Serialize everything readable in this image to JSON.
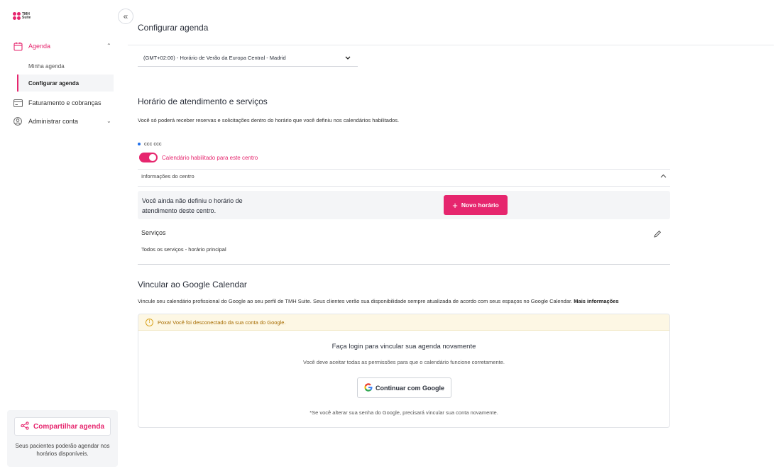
{
  "brand": {
    "logo_line1": "TMH",
    "logo_line2": "Suite",
    "accent": "#e6266e"
  },
  "sidebar": {
    "collapse_icon": "double-chevron-left-icon",
    "agenda": {
      "label": "Agenda",
      "icon": "calendar-icon"
    },
    "agenda_sub": [
      {
        "label": "Minha agenda",
        "active": false
      },
      {
        "label": "Configurar agenda",
        "active": true
      }
    ],
    "billing": {
      "label": "Faturamento e cobranças",
      "icon": "card-icon"
    },
    "account": {
      "label": "Administrar conta",
      "icon": "user-circle-icon"
    },
    "share": {
      "button_label": "Compartilhar agenda",
      "note": "Seus pacientes poderão agendar nos horários disponíveis."
    }
  },
  "main": {
    "title": "Configurar agenda",
    "timezone": {
      "value": "(GMT+02:00) - Horário de Verão da Europa Central - Madrid"
    },
    "hours": {
      "title": "Horário de atendimento e serviços",
      "description": "Você só poderá receber reservas e solicitações dentro do horário que você definiu nos calendários habilitados.",
      "center_name": "ccc ccc",
      "calendar_toggle": {
        "label": "Calendário habilitado para este centro",
        "on": true
      },
      "info_header": "Informações do centro",
      "empty_text": "Você ainda não definiu o horário de atendimento deste centro.",
      "new_button": "Novo horário",
      "services_title": "Serviços",
      "services_desc": "Todos os serviços - horário principal"
    },
    "google": {
      "title": "Vincular ao Google Calendar",
      "description": "Vincule seu calendário profissional do Google ao seu perfil de TMH Suite. Seus clientes verão sua disponibilidade sempre atualizada de acordo com seus espaços no Google Calendar.",
      "more_info": "Mais informações",
      "warning": "Poxa! Você foi desconectado da sua conta do Google.",
      "login_title": "Faça login para vincular sua agenda novamente",
      "login_sub": "Você deve aceitar todas as permissões para que o calendário funcione corretamente.",
      "button": "Continuar com Google",
      "note": "*Se você alterar sua senha do Google, precisará vincular sua conta novamente."
    }
  }
}
